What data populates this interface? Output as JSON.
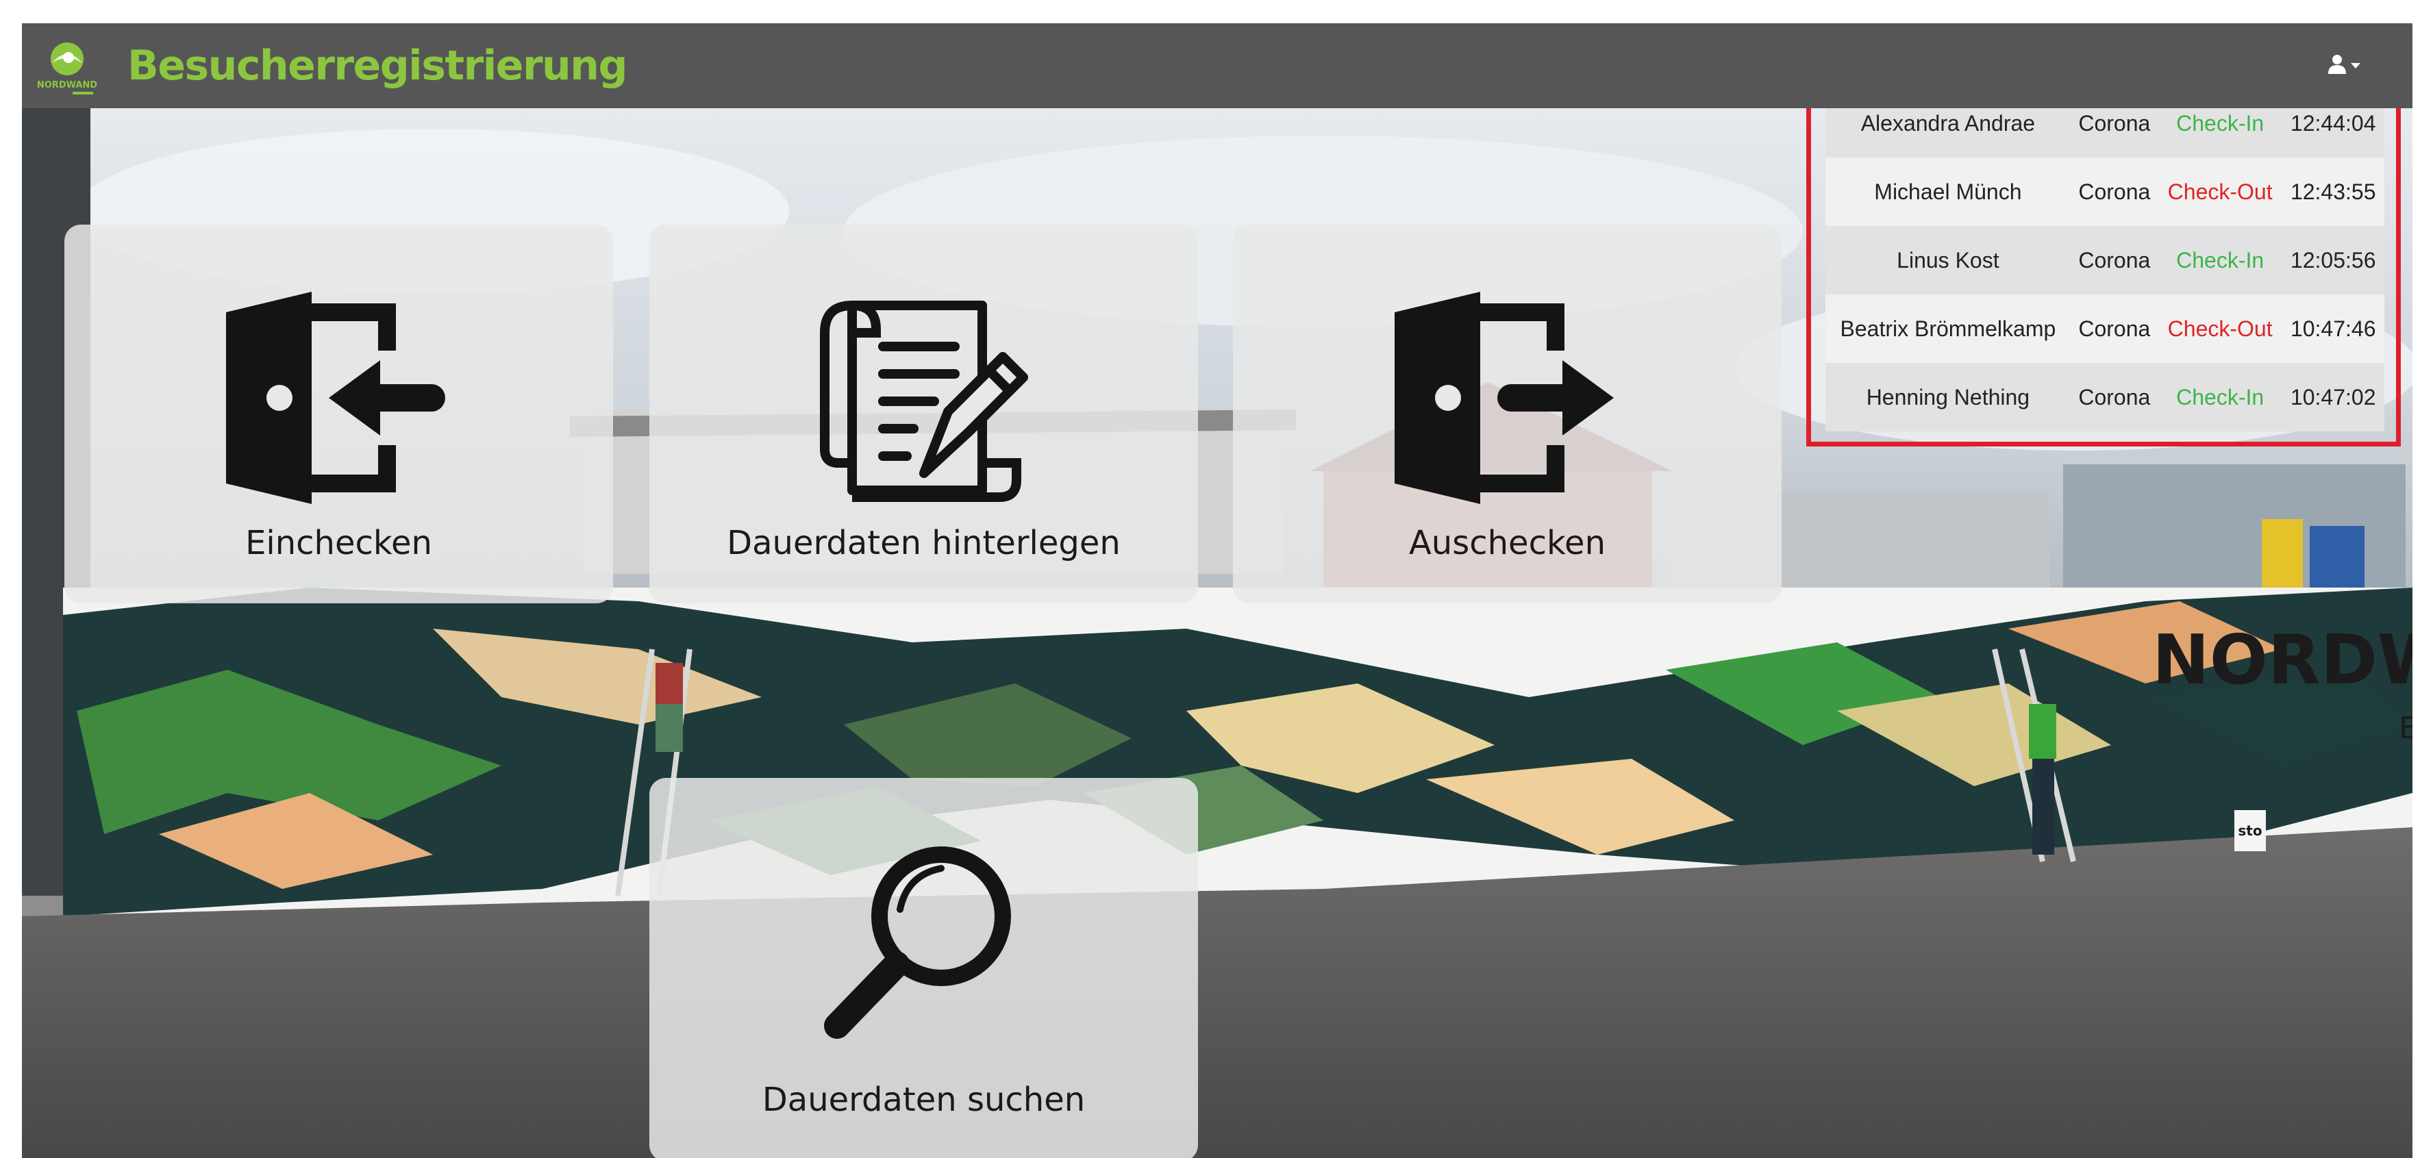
{
  "app": {
    "title": "Besucherregistrierung",
    "logo_text": "NORDWAND",
    "brand_color": "#8cc63f"
  },
  "header": {
    "user_menu_icon": "user-icon",
    "dropdown_icon": "caret-down-icon"
  },
  "tiles": [
    {
      "label": "Einchecken",
      "icon": "door-enter-icon"
    },
    {
      "label": "Dauerdaten hinterlegen",
      "icon": "document-edit-icon"
    },
    {
      "label": "Auschecken",
      "icon": "door-exit-icon"
    },
    {
      "label": "Dauerdaten suchen",
      "icon": "magnifier-icon"
    }
  ],
  "background_mural": {
    "sign_text": "NORDWA",
    "sign_sub": "E",
    "bucket_text": "sto"
  },
  "recent_visitors": [
    {
      "name": "Alexandra Andrae",
      "purpose": "Corona",
      "status": "Check-In",
      "time": "12:44:04"
    },
    {
      "name": "Michael Münch",
      "purpose": "Corona",
      "status": "Check-Out",
      "time": "12:43:55"
    },
    {
      "name": "Linus Kost",
      "purpose": "Corona",
      "status": "Check-In",
      "time": "12:05:56"
    },
    {
      "name": "Beatrix Brömmelkamp",
      "purpose": "Corona",
      "status": "Check-Out",
      "time": "10:47:46"
    },
    {
      "name": "Henning Nething",
      "purpose": "Corona",
      "status": "Check-In",
      "time": "10:47:02"
    }
  ],
  "colors": {
    "navbar": "#565656",
    "check_in": "#3cb54a",
    "check_out": "#e02323",
    "highlight": "#e01e2b"
  }
}
